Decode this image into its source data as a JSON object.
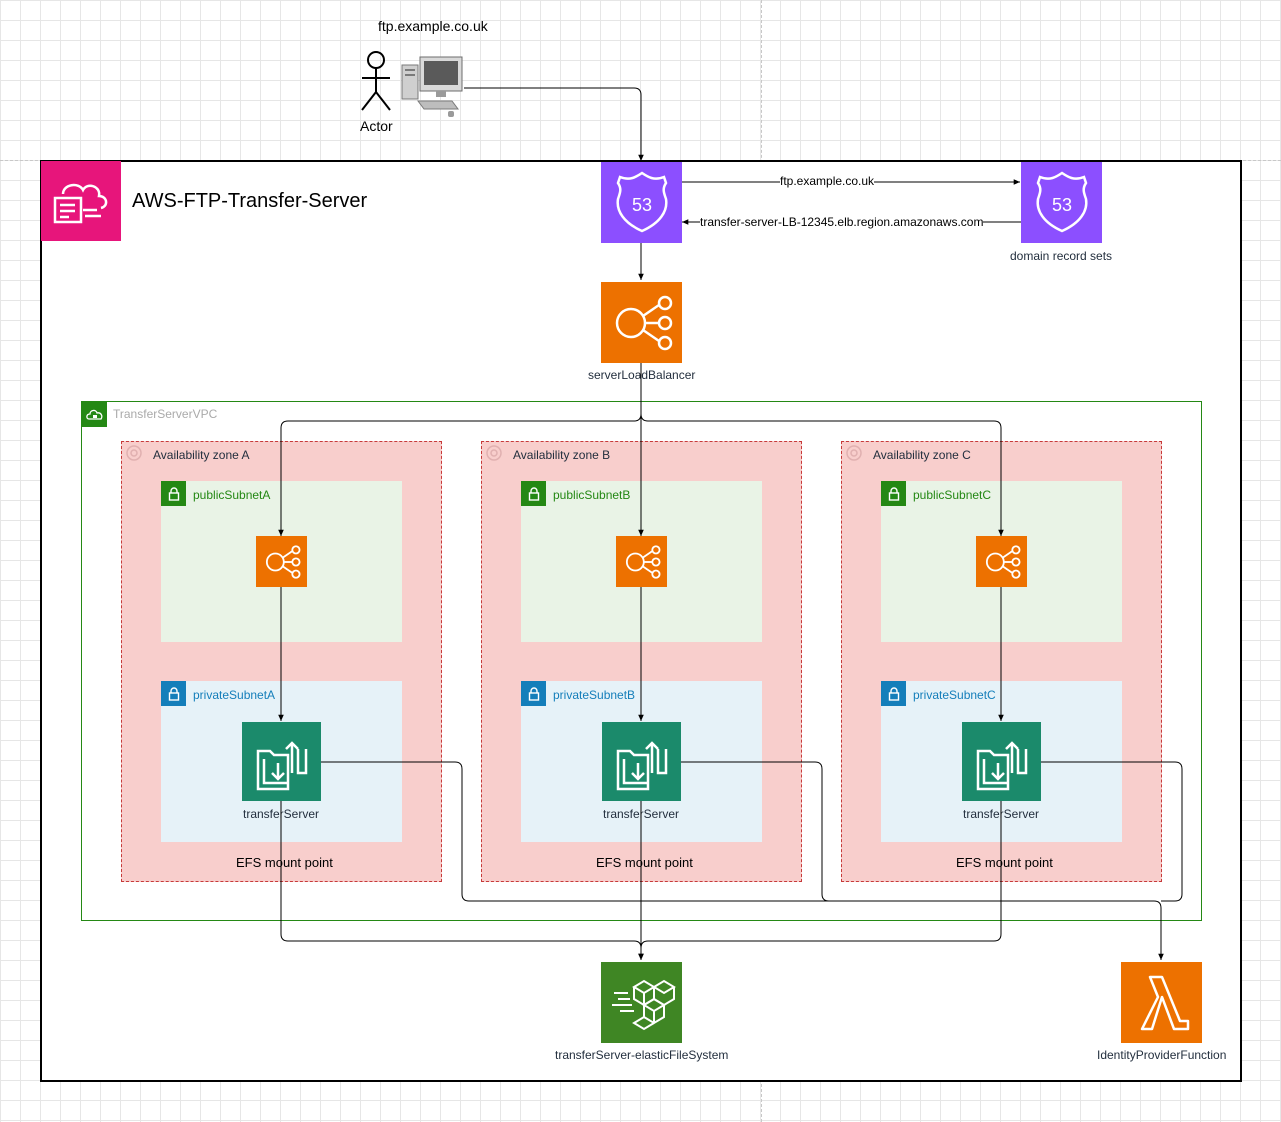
{
  "top": {
    "domain_label": "ftp.example.co.uk",
    "actor_label": "Actor"
  },
  "group": {
    "title": "AWS-FTP-Transfer-Server"
  },
  "dns": {
    "forward_label": "ftp.example.co.uk",
    "return_label": "transfer-server-LB-12345.elb.region.amazonaws.com",
    "record_sets_label": "domain record sets",
    "route53_text": "53"
  },
  "elb": {
    "label": "serverLoadBalancer"
  },
  "vpc": {
    "label": "TransferServerVPC"
  },
  "zones": [
    {
      "label": "Availability zone A",
      "public": "publicSubnetA",
      "private": "privateSubnetA",
      "server": "transferServer",
      "mount": "EFS mount point"
    },
    {
      "label": "Availability zone B",
      "public": "publicSubnetB",
      "private": "privateSubnetB",
      "server": "transferServer",
      "mount": "EFS mount point"
    },
    {
      "label": "Availability zone C",
      "public": "publicSubnetC",
      "private": "privateSubnetC",
      "server": "transferServer",
      "mount": "EFS mount point"
    }
  ],
  "efs": {
    "label": "transferServer-elasticFileSystem"
  },
  "lambda": {
    "label": "IdentityProviderFunction"
  },
  "colors": {
    "route53": "#8c4fff",
    "elb": "#ed7100",
    "transfer": "#1b8a6b",
    "efs": "#3f8624",
    "lambda": "#ed7100",
    "group_header": "#e7157b",
    "vpc_border": "#248814",
    "az_fill": "#f8cecc",
    "public_fill": "#e9f3e6",
    "private_fill": "#e6f2f8"
  }
}
